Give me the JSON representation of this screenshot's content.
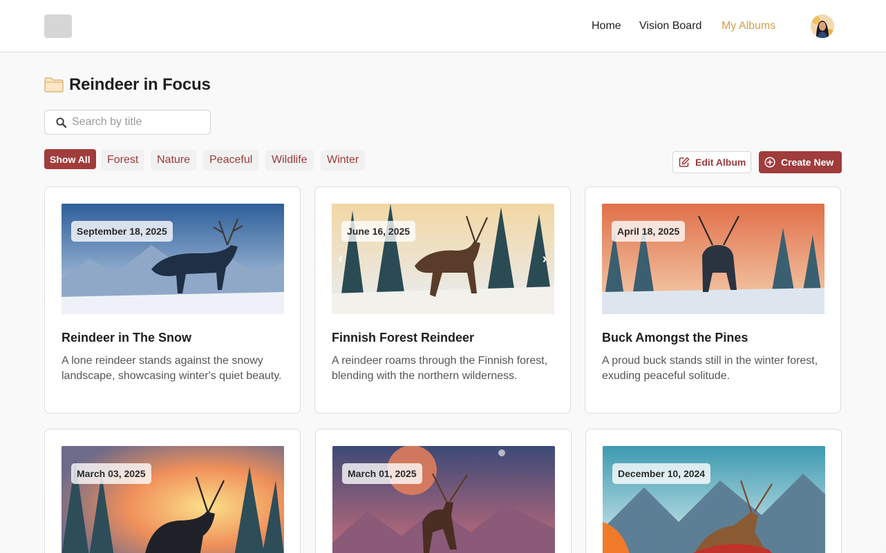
{
  "header": {
    "nav": [
      "Home",
      "Vision Board",
      "My Albums"
    ],
    "active_nav": "My Albums",
    "accent_color": "#d4a04a"
  },
  "album": {
    "title": "Reindeer in Focus"
  },
  "search": {
    "placeholder": "Search by title",
    "value": ""
  },
  "filters": {
    "items": [
      "Show All",
      "Forest",
      "Nature",
      "Peaceful",
      "Wildlife",
      "Winter"
    ],
    "selected": "Show All"
  },
  "actions": {
    "edit_label": "Edit Album",
    "create_label": "Create New"
  },
  "brand_color": "#a03c3c",
  "cards": [
    {
      "date": "September 18, 2025",
      "title": "Reindeer in The Snow",
      "description": "A lone reindeer stands against the snowy landscape, showcasing winter's quiet beauty."
    },
    {
      "date": "June 16, 2025",
      "title": "Finnish Forest Reindeer",
      "description": "A reindeer roams through the Finnish forest, blending with the northern wilderness."
    },
    {
      "date": "April 18, 2025",
      "title": "Buck Amongst the Pines",
      "description": "A proud buck stands still in the winter forest, exuding peaceful solitude."
    },
    {
      "date": "March 03, 2025",
      "title": "",
      "description": ""
    },
    {
      "date": "March 01, 2025",
      "title": "",
      "description": ""
    },
    {
      "date": "December 10, 2024",
      "title": "",
      "description": ""
    }
  ]
}
